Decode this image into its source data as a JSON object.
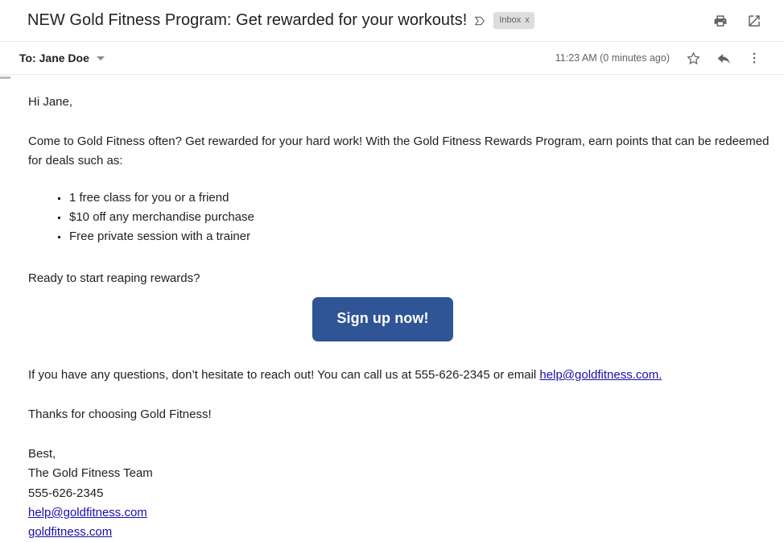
{
  "header": {
    "subject": "NEW Gold Fitness Program: Get rewarded for your workouts!",
    "important_marker_icon": "important-marker-icon",
    "label_chip": {
      "text": "Inbox",
      "remove_label": "x"
    },
    "actions": [
      {
        "name": "print-icon",
        "title": "Print all"
      },
      {
        "name": "open-in-new-window-icon",
        "title": "In new window"
      }
    ]
  },
  "recipient": {
    "to_line": "To: Jane Doe",
    "details_caret_icon": "chevron-down-icon",
    "timestamp": "11:23 AM (0 minutes ago)",
    "actions": [
      {
        "name": "star-icon",
        "title": "Star"
      },
      {
        "name": "reply-icon",
        "title": "Reply"
      },
      {
        "name": "more-options-icon",
        "title": "More"
      }
    ]
  },
  "body": {
    "greeting": "Hi Jane,",
    "intro": "Come to Gold Fitness often? Get rewarded for your hard work! With the Gold Fitness Rewards Program, earn points that can be redeemed for deals such as:",
    "deals": [
      "1 free class for you or a friend",
      "$10 off any merchandise purchase",
      "Free private session with a trainer"
    ],
    "ready": "Ready to start reaping rewards?",
    "cta_label": "Sign up now!",
    "questions_prefix": "If you have any questions, don’t hesitate to reach out! You can call us at 555-626-2345 or email ",
    "questions_email_link": "help@goldfitness.com.",
    "thanks": "Thanks for choosing Gold Fitness!",
    "signature": {
      "closing": "Best,",
      "team": "The Gold Fitness Team",
      "phone": "555-626-2345",
      "email": "help@goldfitness.com",
      "website": "goldfitness.com"
    }
  },
  "colors": {
    "cta_background": "#2f5597",
    "link": "#1a0dab",
    "chip_background": "#ddddde",
    "text": "#202124",
    "muted_text": "#5f6368"
  }
}
